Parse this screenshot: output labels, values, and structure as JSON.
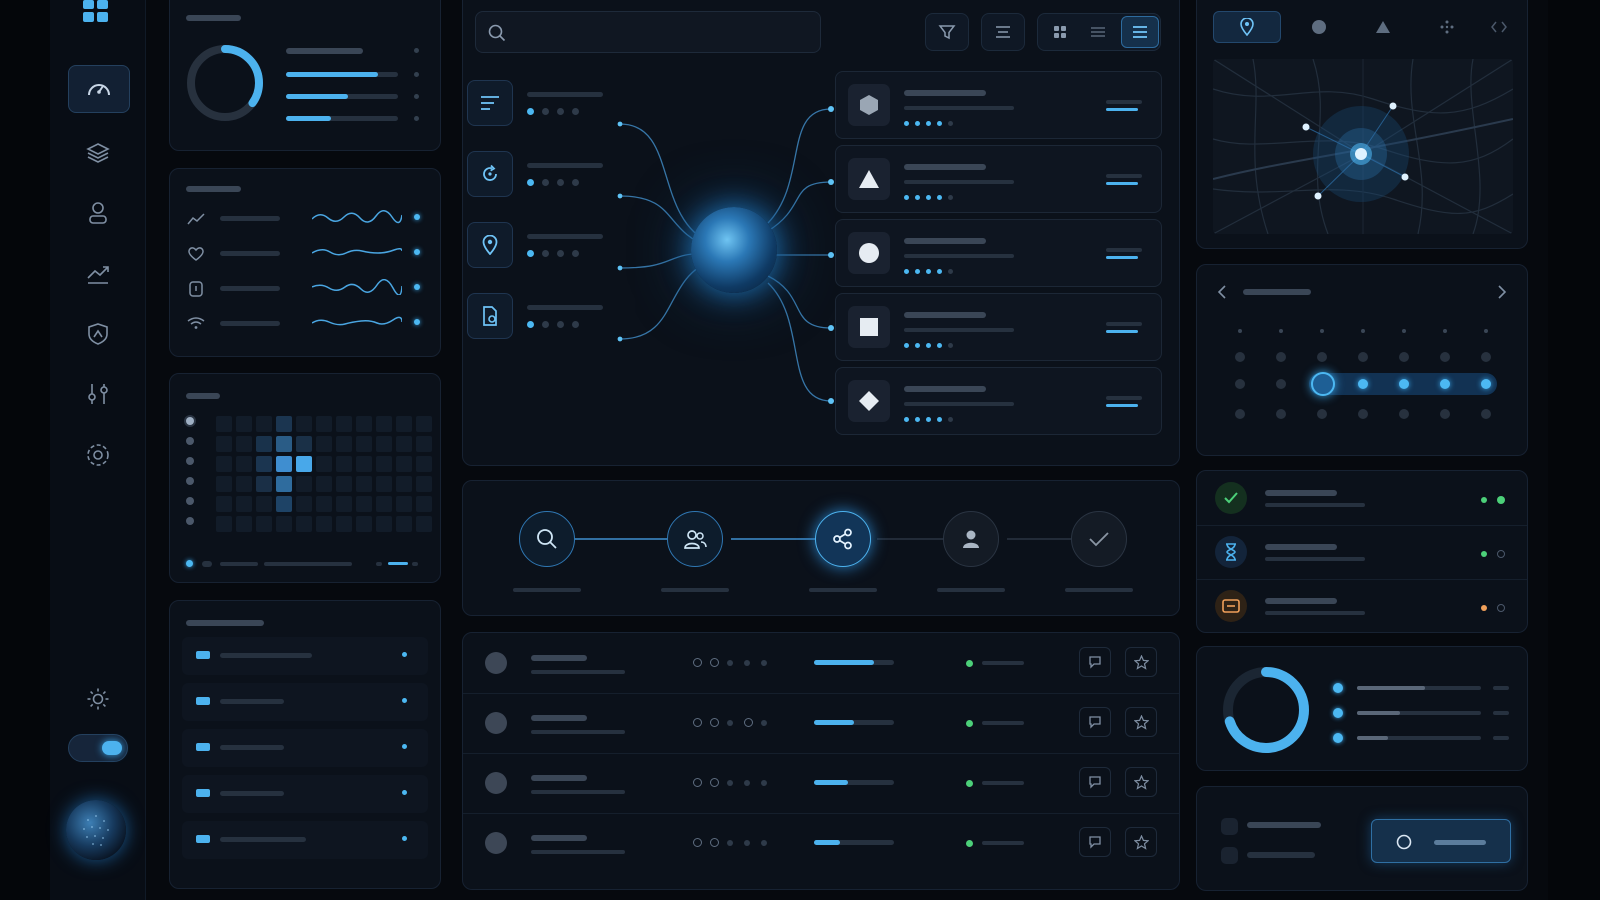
{
  "sidebar": {
    "items": [
      {
        "icon": "speedometer-icon",
        "active": true
      },
      {
        "icon": "layers-icon",
        "active": false
      },
      {
        "icon": "user-icon",
        "active": false
      },
      {
        "icon": "trending-icon",
        "active": false
      },
      {
        "icon": "shield-icon",
        "active": false
      },
      {
        "icon": "sliders-icon",
        "active": false
      },
      {
        "icon": "target-icon",
        "active": false
      }
    ],
    "theme_toggle_on": true
  },
  "progress_card": {
    "ring_fraction": 0.35,
    "bars": [
      0.82,
      0.55,
      0.4
    ]
  },
  "workflow": {
    "steps": [
      {
        "icon": "search-icon",
        "state": "done"
      },
      {
        "icon": "users-icon",
        "state": "done"
      },
      {
        "icon": "share-icon",
        "state": "active"
      },
      {
        "icon": "user-icon",
        "state": "pending"
      },
      {
        "icon": "check-icon",
        "state": "pending"
      }
    ]
  },
  "table": {
    "progress": [
      0.75,
      0.5,
      0.42,
      0.32
    ]
  },
  "map_toolbar": {
    "active": "pin-icon"
  },
  "status_list": {
    "status_colors": [
      "#4cd079",
      "#4cd079",
      "#f0a05a"
    ]
  },
  "stats_card": {
    "ring_fraction": 0.7,
    "bars": [
      0.55,
      0.35,
      0.25
    ]
  },
  "colors": {
    "accent": "#4cb2ee",
    "success": "#4cd079",
    "warning": "#f0a05a",
    "background": "#06090e"
  }
}
